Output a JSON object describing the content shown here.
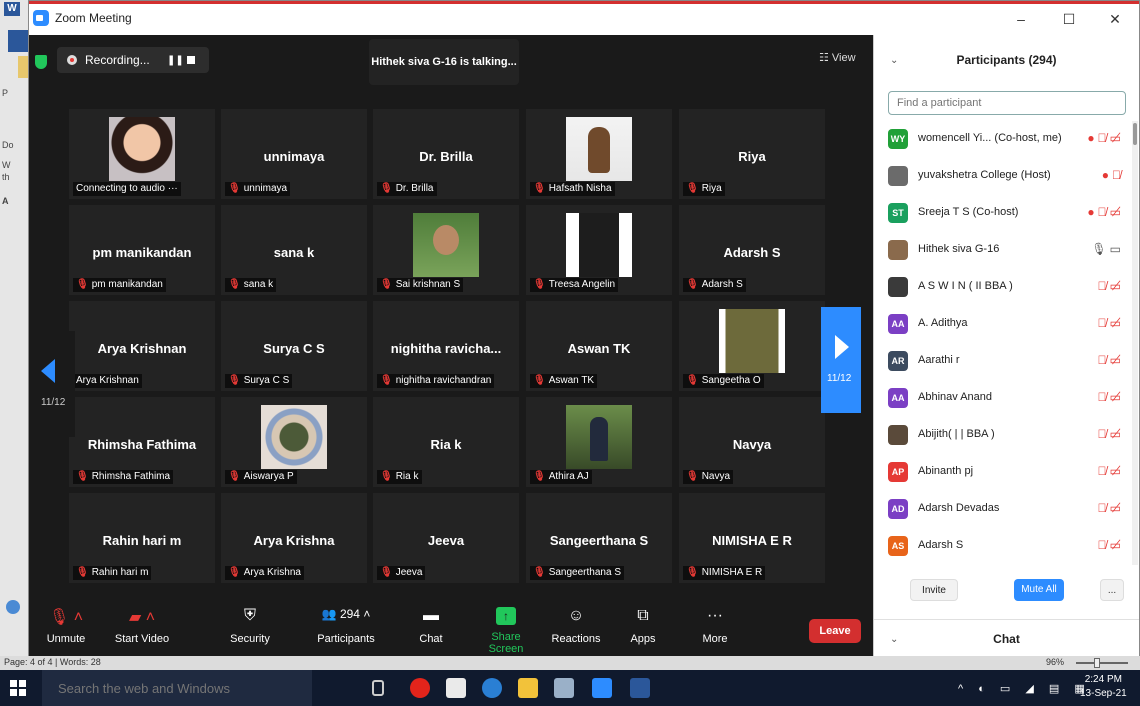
{
  "window": {
    "title": "Zoom Meeting",
    "controls": [
      "–",
      "☐",
      "✕"
    ]
  },
  "word_bg": {
    "letters": [
      "P",
      "Do",
      "W",
      "th",
      "A"
    ]
  },
  "top": {
    "recording_label": "Recording...",
    "pause_icon": "❚❚",
    "talking": "Hithek siva G-16 is talking...",
    "view_label": "☷ View"
  },
  "tiles": [
    {
      "name": "",
      "label": "Connecting to audio ···",
      "muted": false,
      "photo": "ph1"
    },
    {
      "name": "unnimaya",
      "label": "unnimaya",
      "muted": true
    },
    {
      "name": "Dr. Brilla",
      "label": "Dr. Brilla",
      "muted": true
    },
    {
      "name": "",
      "label": "Hafsath Nisha",
      "muted": true,
      "photo": "ph2"
    },
    {
      "name": "Riya",
      "label": "Riya",
      "muted": true
    },
    {
      "name": "pm manikandan",
      "label": "pm manikandan",
      "muted": true
    },
    {
      "name": "sana k",
      "label": "sana k",
      "muted": true
    },
    {
      "name": "",
      "label": "Sai krishnan S",
      "muted": true,
      "photo": "ph3"
    },
    {
      "name": "",
      "label": "Treesa Angelin",
      "muted": true,
      "photo": "ph4"
    },
    {
      "name": "Adarsh S",
      "label": "Adarsh S",
      "muted": true
    },
    {
      "name": "Arya Krishnan",
      "label": "Arya Krishnan",
      "muted": false
    },
    {
      "name": "Surya C S",
      "label": "Surya C S",
      "muted": true
    },
    {
      "name": "nighitha  ravicha...",
      "label": "nighitha ravichandran",
      "muted": true
    },
    {
      "name": "Aswan TK",
      "label": "Aswan TK",
      "muted": true
    },
    {
      "name": "",
      "label": "Sangeetha O",
      "muted": true,
      "photo": "ph5"
    },
    {
      "name": "Rhimsha Fathima",
      "label": "Rhimsha Fathima",
      "muted": true
    },
    {
      "name": "",
      "label": "Aiswarya P",
      "muted": true,
      "photo": "ph6"
    },
    {
      "name": "Ria k",
      "label": "Ria k",
      "muted": true
    },
    {
      "name": "",
      "label": "Athira AJ",
      "muted": true,
      "photo": "ph7"
    },
    {
      "name": "Navya",
      "label": "Navya",
      "muted": true
    },
    {
      "name": "Rahin hari m",
      "label": "Rahin hari m",
      "muted": true
    },
    {
      "name": "Arya Krishna",
      "label": "Arya Krishna",
      "muted": true
    },
    {
      "name": "Jeeva",
      "label": "Jeeva",
      "muted": true
    },
    {
      "name": "Sangeerthana S",
      "label": "Sangeerthana S",
      "muted": true
    },
    {
      "name": "NIMISHA E R",
      "label": "NIMISHA E R",
      "muted": true
    }
  ],
  "nav": {
    "left_page": "11/12",
    "right_page": "11/12"
  },
  "toolbar": {
    "unmute": "Unmute",
    "start_video": "Start Video",
    "security": "Security",
    "participants": "Participants",
    "participants_count": "294",
    "chat": "Chat",
    "share_screen": "Share Screen",
    "reactions": "Reactions",
    "apps": "Apps",
    "more": "More",
    "leave": "Leave"
  },
  "panel": {
    "title": "Participants (294)",
    "search_placeholder": "Find a participant",
    "invite": "Invite",
    "mute_all": "Mute All",
    "more": "...",
    "chat_title": "Chat",
    "participants": [
      {
        "initials": "WY",
        "color": "#21a038",
        "name": "womencell Yi... (Co-host, me)",
        "icons": "rec mic-off cam-off"
      },
      {
        "initials": "",
        "color": "#6b6b6b",
        "name": "yuvakshetra College (Host)",
        "icons": "rec mic-off"
      },
      {
        "initials": "ST",
        "color": "#1aa05e",
        "name": "Sreeja T S (Co-host)",
        "icons": "rec mic-off cam-off"
      },
      {
        "initials": "",
        "color": "#8a6a4c",
        "name": "Hithek siva G-16",
        "icons": "mic-on cam-on"
      },
      {
        "initials": "",
        "color": "#3a3a3a",
        "name": "A S W I N ( II BBA )",
        "icons": "mic-off cam-off"
      },
      {
        "initials": "AA",
        "color": "#7b3fc4",
        "name": "A. Adithya",
        "icons": "mic-off cam-off"
      },
      {
        "initials": "AR",
        "color": "#3c4b5f",
        "name": "Aarathi r",
        "icons": "mic-off cam-off"
      },
      {
        "initials": "AA",
        "color": "#7b3fc4",
        "name": "Abhinav Anand",
        "icons": "mic-off cam-off"
      },
      {
        "initials": "",
        "color": "#5a4a3a",
        "name": "Abijith( | | BBA )",
        "icons": "mic-off cam-off"
      },
      {
        "initials": "AP",
        "color": "#e53935",
        "name": "Abinanth pj",
        "icons": "mic-off cam-off"
      },
      {
        "initials": "AD",
        "color": "#7b3fc4",
        "name": "Adarsh Devadas",
        "icons": "mic-off cam-off"
      },
      {
        "initials": "AS",
        "color": "#e8641a",
        "name": "Adarsh S",
        "icons": "mic-off cam-off"
      }
    ]
  },
  "statusbar": {
    "page": "Page: 4 of 4",
    "words": "Words: 28",
    "zoom": "96%"
  },
  "taskbar": {
    "search": "Search the web and Windows",
    "time": "2:24 PM",
    "date": "13-Sep-21"
  },
  "colors": {
    "zoom_blue": "#2d8cff",
    "leave_red": "#d32f2f",
    "share_green": "#21c75b"
  }
}
